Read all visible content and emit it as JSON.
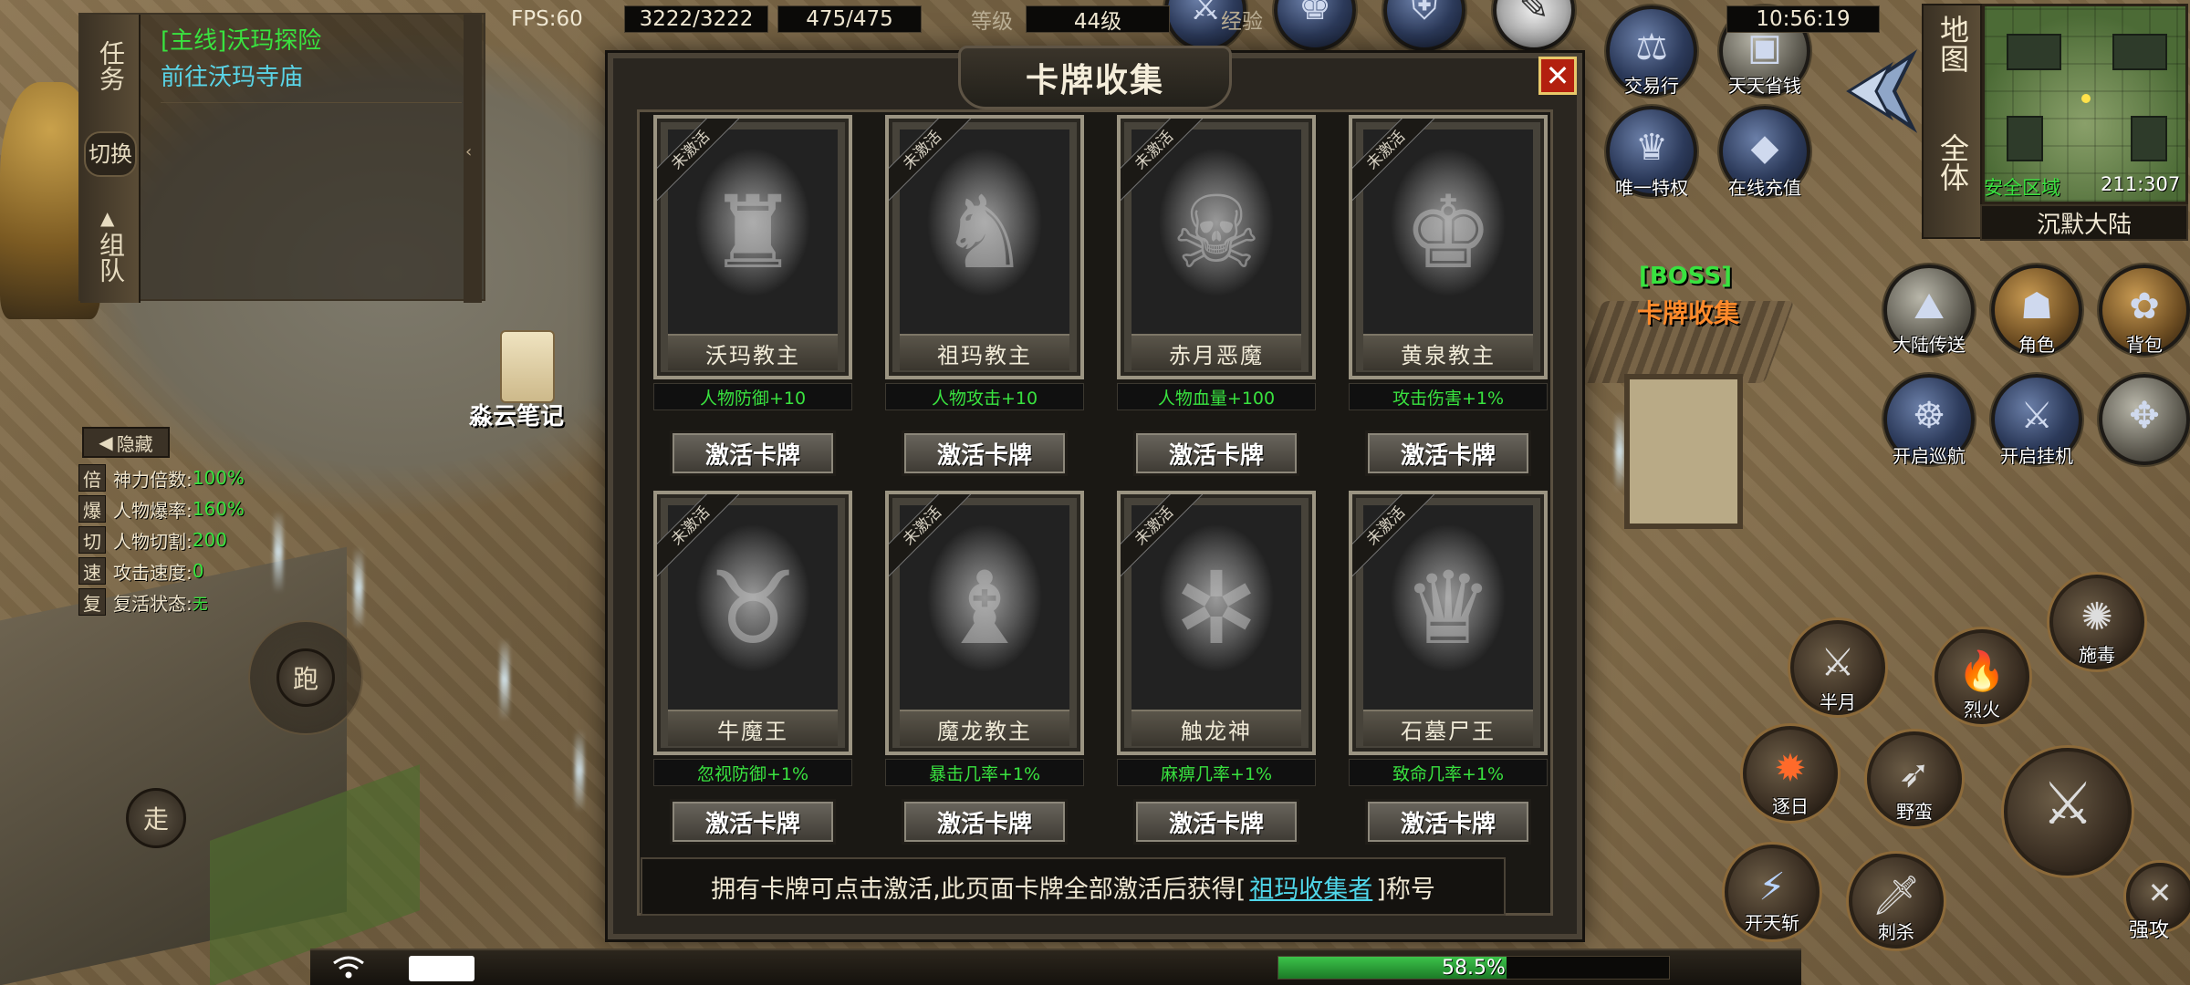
{
  "quest": {
    "tabs": {
      "task": "任务",
      "switch": "切换",
      "team": "组队"
    },
    "title": "[主线]沃玛探险",
    "subtitle": "前往沃玛寺庙"
  },
  "stats": {
    "hide_label": "隐藏",
    "rows": [
      {
        "badge": "倍",
        "label": "神力倍数:",
        "value": "100%"
      },
      {
        "badge": "爆",
        "label": "人物爆率:",
        "value": "160%"
      },
      {
        "badge": "切",
        "label": "人物切割:",
        "value": "200"
      },
      {
        "badge": "速",
        "label": "攻击速度:",
        "value": "0"
      },
      {
        "badge": "复",
        "label": "复活状态:",
        "value": "无"
      }
    ]
  },
  "movement": {
    "run": "跑",
    "walk": "走"
  },
  "npc_label": "淼云笔记",
  "boss_label": {
    "tag": "[BOSS]",
    "name": "卡牌收集"
  },
  "minimap": {
    "tab_map": "地图",
    "tab_all": "全体",
    "zone": "安全区域",
    "coords": "211:307",
    "map_name": "沉默大陆"
  },
  "top_icons": [
    {
      "name": "交易行",
      "key": "trade"
    },
    {
      "name": "天天省钱",
      "key": "save"
    },
    {
      "name": "唯一特权",
      "key": "privilege"
    },
    {
      "name": "在线充值",
      "key": "recharge"
    }
  ],
  "side_icons": [
    {
      "name": "大陆传送",
      "key": "teleport"
    },
    {
      "name": "角色",
      "key": "role"
    },
    {
      "name": "背包",
      "key": "bag"
    },
    {
      "name": "开启巡航",
      "key": "cruise"
    },
    {
      "name": "开启挂机",
      "key": "auto"
    }
  ],
  "skills": {
    "poison": "施毒",
    "half_moon": "半月",
    "fire": "烈火",
    "sunset": "逐日",
    "wild": "野蛮",
    "open_sky": "开天斩",
    "stab": "刺杀",
    "strong": "强攻"
  },
  "dialog": {
    "title": "卡牌收集",
    "close": "✕",
    "ribbon": "未激活",
    "activate_label": "激活卡牌",
    "cards": [
      {
        "name": "沃玛教主",
        "bonus": "人物防御+10"
      },
      {
        "name": "祖玛教主",
        "bonus": "人物攻击+10"
      },
      {
        "name": "赤月恶魔",
        "bonus": "人物血量+100"
      },
      {
        "name": "黄泉教主",
        "bonus": "攻击伤害+1%"
      },
      {
        "name": "牛魔王",
        "bonus": "忽视防御+1%"
      },
      {
        "name": "魔龙教主",
        "bonus": "暴击几率+1%"
      },
      {
        "name": "触龙神",
        "bonus": "麻痹几率+1%"
      },
      {
        "name": "石墓尸王",
        "bonus": "致命几率+1%"
      }
    ],
    "footer_pre": "拥有卡牌可点击激活,此页面卡牌全部激活后获得[",
    "footer_link": "祖玛收集者",
    "footer_post": "]称号"
  },
  "status_bar": {
    "fps": "FPS:60",
    "hp": "3222/3222",
    "mp": "475/475",
    "level_label": "等级",
    "level_value": "44级",
    "exp_label": "经验",
    "exp_text": "58.5%",
    "exp_fraction": 0.585,
    "time": "10:56:19"
  }
}
